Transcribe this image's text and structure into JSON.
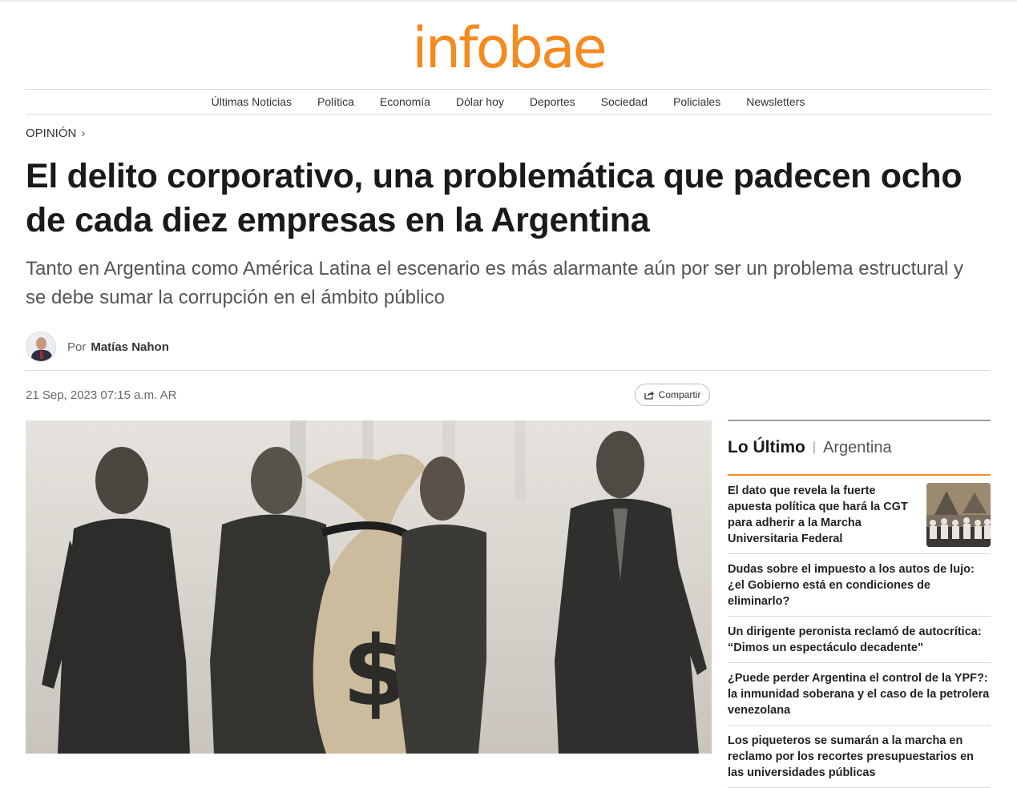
{
  "brand": {
    "logo_text": "infobae",
    "accent": "#f68a1f"
  },
  "nav": {
    "items": [
      "Últimas Noticias",
      "Política",
      "Economía",
      "Dólar hoy",
      "Deportes",
      "Sociedad",
      "Policiales",
      "Newsletters"
    ]
  },
  "article": {
    "section": "OPINIÓN",
    "title": "El delito corporativo, una problemática que padecen ocho de cada diez empresas en la Argentina",
    "subtitle": "Tanto en Argentina como América Latina el escenario es más alarmante aún por ser un problema estructural y se debe sumar la corrupción en el ámbito público",
    "author_prefix": "Por",
    "author_name": "Matías Nahon",
    "date": "21 Sep, 2023 07:15 a.m. AR",
    "share_label": "Compartir"
  },
  "sidebar": {
    "title": "Lo Último",
    "subtitle": "Argentina",
    "items": [
      {
        "text": "El dato que revela la fuerte apuesta política que hará la CGT para adherir a la Marcha Universitaria Federal",
        "has_image": true
      },
      {
        "text": "Dudas sobre el impuesto a los autos de lujo: ¿el Gobierno está en condiciones de eliminarlo?",
        "has_image": false
      },
      {
        "text": "Un dirigente peronista reclamó de autocrítica: “Dimos un espectáculo decadente”",
        "has_image": false
      },
      {
        "text": "¿Puede perder Argentina el control de la YPF?: la inmunidad soberana y el caso de la petrolera venezolana",
        "has_image": false
      },
      {
        "text": "Los piqueteros se sumarán a la marcha en reclamo por los recortes presupuestarios en las universidades públicas",
        "has_image": false
      }
    ]
  }
}
